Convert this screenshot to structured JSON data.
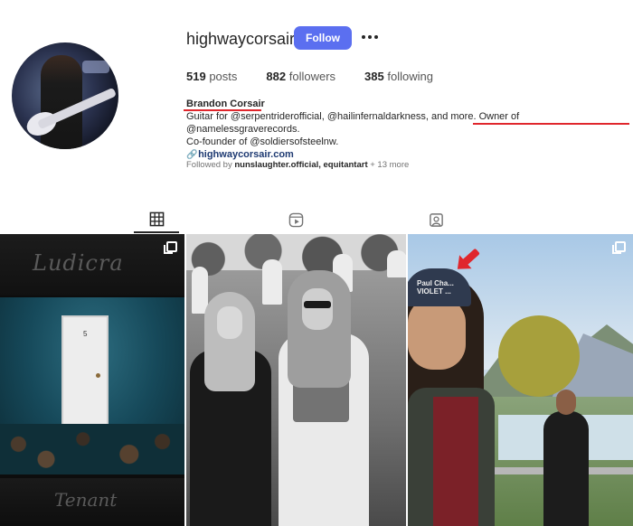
{
  "profile": {
    "username": "highwaycorsair",
    "follow_label": "Follow",
    "stats": {
      "posts_count": "519",
      "posts_label": "posts",
      "followers_count": "882",
      "followers_label": "followers",
      "following_count": "385",
      "following_label": "following"
    },
    "bio": {
      "name": "Brandon Corsair",
      "line1_start": "Guitar for @serpentriderofficial, @hailinfernaldarkness, and more. ",
      "line1_highlight": "Owner of @namelessgraverecords.",
      "line2": "Co-founder of @soldiersofsteelnw.",
      "website": "highwaycorsair.com",
      "link_icon": "link-icon"
    },
    "followed_by": {
      "prefix": "Followed by",
      "users": "nunslaughter.official, equitantart",
      "more": "+ 13 more"
    }
  },
  "tabs": [
    {
      "name": "posts",
      "icon": "grid-icon",
      "active": true
    },
    {
      "name": "reels",
      "icon": "reels-icon",
      "active": false
    },
    {
      "name": "tagged",
      "icon": "tagged-icon",
      "active": false
    }
  ],
  "posts": [
    {
      "text_top": "Ludicra",
      "text_bottom": "Tenant",
      "door_number": "5",
      "multi": true
    },
    {
      "multi": false
    },
    {
      "cap_text": "Paul Cha... VIOLET ...",
      "multi": true
    }
  ],
  "colors": {
    "follow_button": "#5b6ff0",
    "annotation_red": "#e0262c",
    "link": "#1e3a72"
  }
}
